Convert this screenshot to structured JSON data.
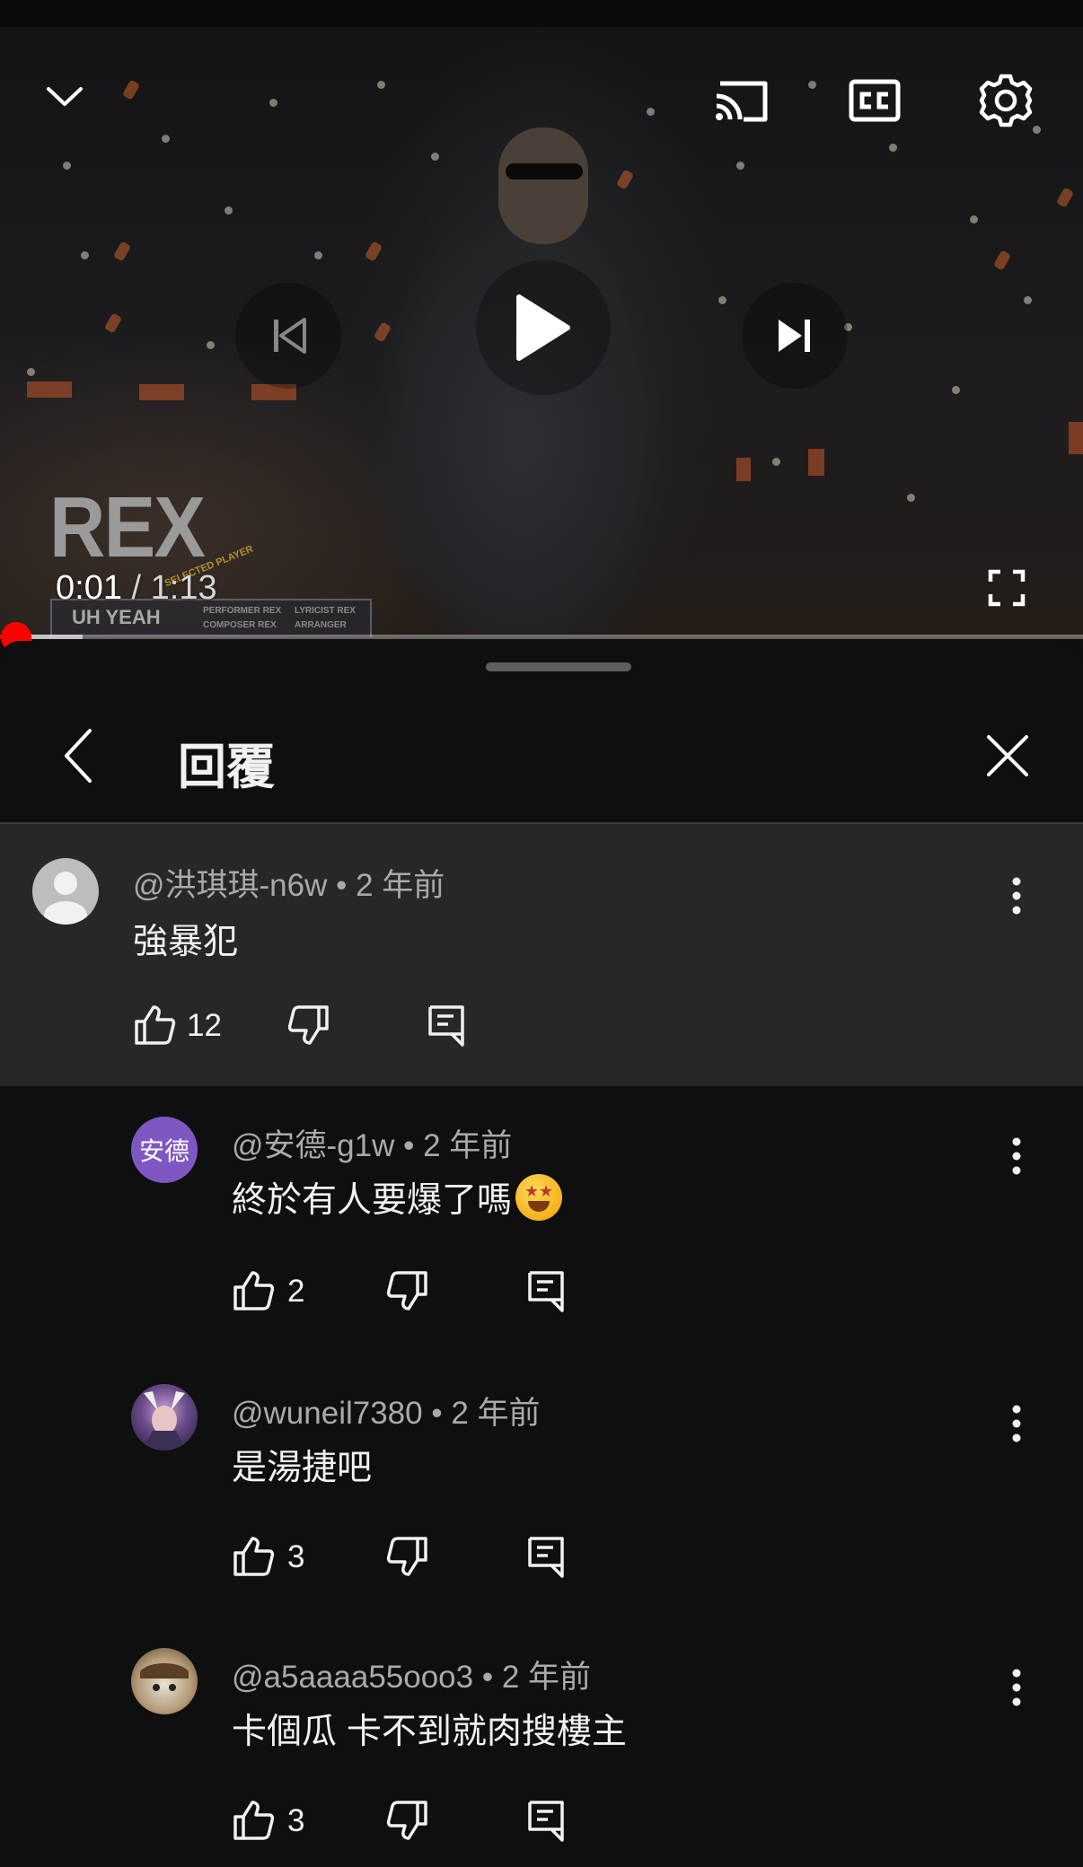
{
  "player": {
    "current_time": "0:01",
    "time_separator": " / ",
    "total_time": "1:13",
    "progress_fraction": 0.014,
    "buffered_fraction": 0.076,
    "overlay": {
      "performer_name": "REX",
      "badge": "SELECTED PLAYER",
      "song": "UH YEAH",
      "credits": [
        "PERFORMER REX",
        "LYRICIST REX",
        "COMPOSER REX",
        "ARRANGER"
      ]
    },
    "icons": [
      "chevron-down-icon",
      "cast-icon",
      "cc-icon",
      "settings-icon",
      "previous-icon",
      "play-icon",
      "next-icon",
      "fullscreen-icon"
    ]
  },
  "panel": {
    "title": "回覆",
    "icons": [
      "back-icon",
      "close-icon"
    ]
  },
  "comments": [
    {
      "author": "@洪琪琪-n6w",
      "age": "2 年前",
      "text": "強暴犯",
      "likes": "12",
      "avatar_kind": "default-gray",
      "parent": true
    },
    {
      "author": "@安德-g1w",
      "age": "2 年前",
      "text": "終於有人要爆了嗎",
      "emoji": "star-struck",
      "likes": "2",
      "avatar_label": "安德",
      "avatar_color": "#7e57c2",
      "parent": false
    },
    {
      "author": "@wuneil7380",
      "age": "2 年前",
      "text": "是湯捷吧",
      "likes": "3",
      "avatar_kind": "anime-character",
      "parent": false
    },
    {
      "author": "@a5aaaa55ooo3",
      "age": "2 年前",
      "text": "卡個瓜 卡不到就肉搜樓主",
      "likes": "3",
      "avatar_kind": "cat-photo",
      "parent": false
    }
  ],
  "meta_separator": " • ",
  "colors": {
    "accent_red": "#ff0000",
    "panel_bg": "#0f0f0f",
    "parent_bg": "#272727",
    "meta_gray": "#aaaaaa"
  }
}
